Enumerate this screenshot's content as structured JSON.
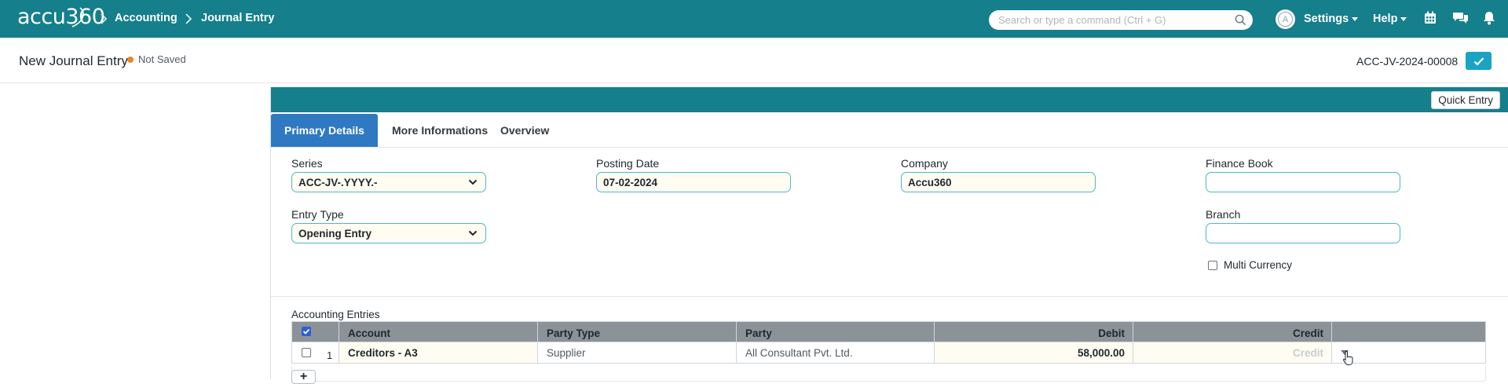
{
  "app": {
    "logo_text": "accu360"
  },
  "breadcrumbs": [
    {
      "label": "Accounting"
    },
    {
      "label": "Journal Entry"
    }
  ],
  "search": {
    "placeholder": "Search or type a command (Ctrl + G)",
    "value": ""
  },
  "user": {
    "avatar_initial": "A"
  },
  "nav": {
    "settings_label": "Settings",
    "help_label": "Help"
  },
  "page": {
    "title": "New Journal Entry",
    "status": "Not Saved",
    "status_color": "#e8862a",
    "doc_name": "ACC-JV-2024-00008"
  },
  "toolbar": {
    "quick_entry_label": "Quick Entry"
  },
  "tabs": [
    {
      "label": "Primary Details",
      "active": true
    },
    {
      "label": "More Informations",
      "active": false
    },
    {
      "label": "Overview",
      "active": false
    }
  ],
  "fields": {
    "series": {
      "label": "Series",
      "value": "ACC-JV-.YYYY.-"
    },
    "posting_date": {
      "label": "Posting Date",
      "value": "07-02-2024"
    },
    "company": {
      "label": "Company",
      "value": "Accu360"
    },
    "finance_book": {
      "label": "Finance Book",
      "value": ""
    },
    "entry_type": {
      "label": "Entry Type",
      "value": "Opening Entry"
    },
    "branch": {
      "label": "Branch",
      "value": ""
    },
    "multi_currency": {
      "label": "Multi Currency",
      "checked": false
    }
  },
  "accounting_entries": {
    "label": "Accounting Entries",
    "columns": [
      "Account",
      "Party Type",
      "Party",
      "Debit",
      "Credit"
    ],
    "rows": [
      {
        "idx": "1",
        "account": "Creditors - A3",
        "party_type": "Supplier",
        "party": "All Consultant Pvt. Ltd.",
        "debit": "58,000.00",
        "credit": "Credit"
      }
    ],
    "add_row_label": "+"
  },
  "colors": {
    "navbar": "#157f8c",
    "active_tab": "#2e79c2",
    "save_button": "#1aa3c2",
    "grid_header": "#8b9298"
  }
}
